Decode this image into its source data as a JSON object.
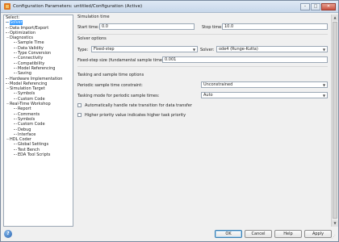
{
  "window": {
    "title": "Configuration Parameters: untitled/Configuration (Active)",
    "buttons": [
      "–",
      "□",
      "✕"
    ]
  },
  "tree": {
    "header": "Select:",
    "items": [
      {
        "label": "Solver",
        "level": 0,
        "selected": true,
        "expander": ""
      },
      {
        "label": "Data Import/Export",
        "level": 0,
        "selected": false,
        "expander": ""
      },
      {
        "label": "Optimization",
        "level": 0,
        "selected": false,
        "expander": ""
      },
      {
        "label": "Diagnostics",
        "level": 0,
        "selected": false,
        "expander": "−"
      },
      {
        "label": "Sample Time",
        "level": 1,
        "selected": false,
        "expander": ""
      },
      {
        "label": "Data Validity",
        "level": 1,
        "selected": false,
        "expander": ""
      },
      {
        "label": "Type Conversion",
        "level": 1,
        "selected": false,
        "expander": ""
      },
      {
        "label": "Connectivity",
        "level": 1,
        "selected": false,
        "expander": ""
      },
      {
        "label": "Compatibility",
        "level": 1,
        "selected": false,
        "expander": ""
      },
      {
        "label": "Model Referencing",
        "level": 1,
        "selected": false,
        "expander": ""
      },
      {
        "label": "Saving",
        "level": 1,
        "selected": false,
        "expander": ""
      },
      {
        "label": "Hardware Implementation",
        "level": 0,
        "selected": false,
        "expander": ""
      },
      {
        "label": "Model Referencing",
        "level": 0,
        "selected": false,
        "expander": ""
      },
      {
        "label": "Simulation Target",
        "level": 0,
        "selected": false,
        "expander": "−"
      },
      {
        "label": "Symbols",
        "level": 1,
        "selected": false,
        "expander": ""
      },
      {
        "label": "Custom Code",
        "level": 1,
        "selected": false,
        "expander": ""
      },
      {
        "label": "Real-Time Workshop",
        "level": 0,
        "selected": false,
        "expander": "−"
      },
      {
        "label": "Report",
        "level": 1,
        "selected": false,
        "expander": ""
      },
      {
        "label": "Comments",
        "level": 1,
        "selected": false,
        "expander": ""
      },
      {
        "label": "Symbols",
        "level": 1,
        "selected": false,
        "expander": ""
      },
      {
        "label": "Custom Code",
        "level": 1,
        "selected": false,
        "expander": ""
      },
      {
        "label": "Debug",
        "level": 1,
        "selected": false,
        "expander": ""
      },
      {
        "label": "Interface",
        "level": 1,
        "selected": false,
        "expander": ""
      },
      {
        "label": "HDL Coder",
        "level": 0,
        "selected": false,
        "expander": "−"
      },
      {
        "label": "Global Settings",
        "level": 1,
        "selected": false,
        "expander": ""
      },
      {
        "label": "Test Bench",
        "level": 1,
        "selected": false,
        "expander": ""
      },
      {
        "label": "EDA Tool Scripts",
        "level": 1,
        "selected": false,
        "expander": ""
      }
    ]
  },
  "simulation_time": {
    "section_label": "Simulation time",
    "start_label": "Start time:",
    "start_value": "0.0",
    "stop_label": "Stop time:",
    "stop_value": "10.0"
  },
  "solver_options": {
    "section_label": "Solver options",
    "type_label": "Type:",
    "type_value": "Fixed-step",
    "solver_label": "Solver:",
    "solver_value": "ode4 (Runge-Kutta)",
    "step_label": "Fixed-step size (fundamental sample time):",
    "step_value": "0.001"
  },
  "tasking": {
    "section_label": "Tasking and sample time options",
    "periodic_label": "Periodic sample time constraint:",
    "periodic_value": "Unconstrained",
    "mode_label": "Tasking mode for periodic sample times:",
    "mode_value": "Auto",
    "auto_rate_label": "Automatically handle rate transition for data transfer",
    "higher_priority_label": "Higher priority value indicates higher task priority"
  },
  "footer": {
    "help_icon": "?",
    "ok_label": "OK",
    "cancel_label": "Cancel",
    "help_label": "Help",
    "apply_label": "Apply"
  }
}
